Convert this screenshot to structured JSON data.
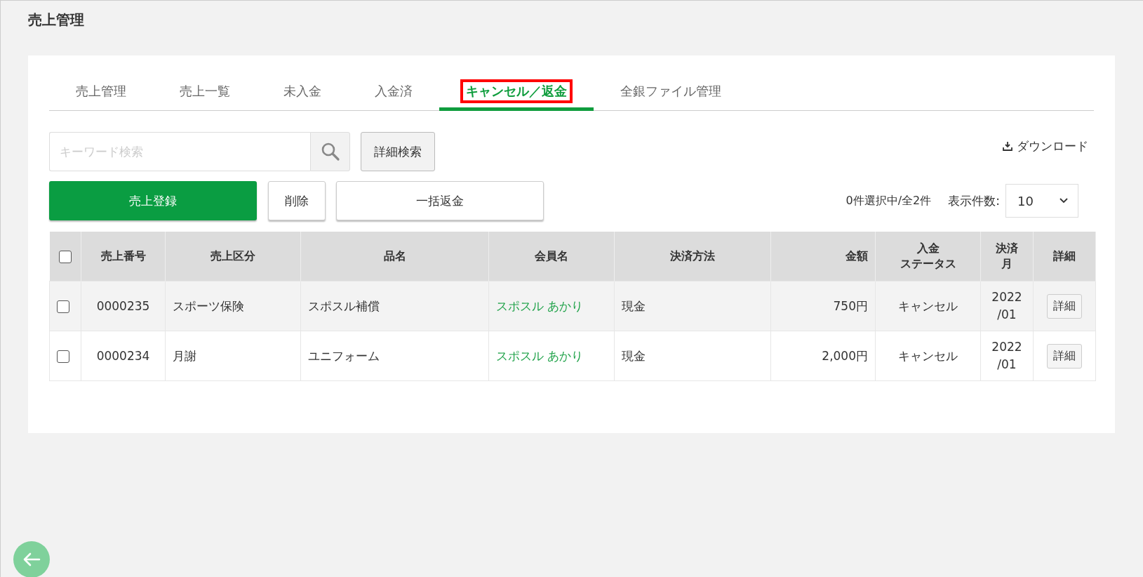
{
  "page_title": "売上管理",
  "tabs": [
    {
      "label": "売上管理",
      "selected": false,
      "highlighted": false
    },
    {
      "label": "売上一覧",
      "selected": false,
      "highlighted": false
    },
    {
      "label": "未入金",
      "selected": false,
      "highlighted": false
    },
    {
      "label": "入金済",
      "selected": false,
      "highlighted": false
    },
    {
      "label": "キャンセル／返金",
      "selected": true,
      "highlighted": true
    },
    {
      "label": "全銀ファイル管理",
      "selected": false,
      "highlighted": false
    }
  ],
  "search": {
    "placeholder": "キーワード検索"
  },
  "detail_search_button": "詳細検索",
  "download_link": "ダウンロード",
  "buttons": [
    {
      "label": "売上登録",
      "kind": "primary"
    },
    {
      "label": "削除",
      "kind": "plain"
    },
    {
      "label": "一括返金",
      "kind": "wide"
    }
  ],
  "selection_count": "0件選択中/全2件",
  "page_size": {
    "label": "表示件数:",
    "value": "10"
  },
  "table": {
    "select_all_checked": false,
    "columns": [
      {
        "lines": [
          "売上番号"
        ]
      },
      {
        "lines": [
          "売上区分"
        ]
      },
      {
        "lines": [
          "品名"
        ]
      },
      {
        "lines": [
          "会員名"
        ]
      },
      {
        "lines": [
          "決済方法"
        ]
      },
      {
        "lines": [
          "金額"
        ]
      },
      {
        "lines": [
          "入金",
          "ステータス"
        ]
      },
      {
        "lines": [
          "決済",
          "月"
        ]
      },
      {
        "lines": [
          "詳細"
        ]
      }
    ],
    "rows": [
      {
        "checked": false,
        "number": "0000235",
        "category": "スポーツ保険",
        "item": "スポスル補償",
        "member": "スポスル あかり",
        "payment": "現金",
        "amount": "750円",
        "status": "キャンセル",
        "month": "2022\n/01",
        "detail": "詳細"
      },
      {
        "checked": false,
        "number": "0000234",
        "category": "月謝",
        "item": "ユニフォーム",
        "member": "スポスル あかり",
        "payment": "現金",
        "amount": "2,000円",
        "status": "キャンセル",
        "month": "2022\n/01",
        "detail": "詳細"
      }
    ]
  }
}
